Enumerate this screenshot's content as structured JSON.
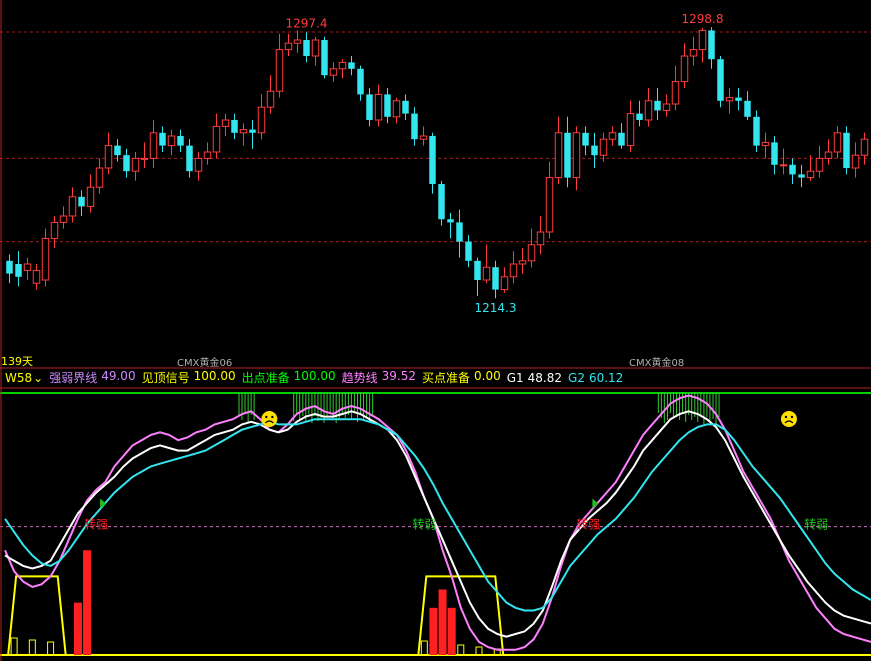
{
  "chart_data": {
    "type": "candlestick",
    "main": {
      "high_label": [
        "1297.4",
        "1298.8"
      ],
      "low_label": "1214.3",
      "period_label": "139天",
      "contract_labels": [
        "CMX黄金06",
        "CMX黄金08"
      ],
      "ylim": [
        1195,
        1305
      ],
      "candles": [
        [
          1226,
          1222,
          1228,
          1219
        ],
        [
          1225,
          1221,
          1229,
          1218
        ],
        [
          1223,
          1225,
          1227,
          1220
        ],
        [
          1219,
          1223,
          1225,
          1217
        ],
        [
          1220,
          1233,
          1236,
          1218
        ],
        [
          1233,
          1238,
          1240,
          1230
        ],
        [
          1238,
          1240,
          1243,
          1236
        ],
        [
          1240,
          1246,
          1249,
          1238
        ],
        [
          1246,
          1243,
          1248,
          1240
        ],
        [
          1243,
          1249,
          1253,
          1241
        ],
        [
          1249,
          1255,
          1258,
          1247
        ],
        [
          1255,
          1262,
          1266,
          1253
        ],
        [
          1262,
          1259,
          1264,
          1257
        ],
        [
          1259,
          1254,
          1261,
          1252
        ],
        [
          1254,
          1258,
          1260,
          1251
        ],
        [
          1258,
          1258,
          1263,
          1255
        ],
        [
          1258,
          1266,
          1270,
          1255
        ],
        [
          1266,
          1262,
          1268,
          1260
        ],
        [
          1262,
          1265,
          1267,
          1259
        ],
        [
          1265,
          1262,
          1267,
          1260
        ],
        [
          1262,
          1254,
          1264,
          1252
        ],
        [
          1254,
          1258,
          1260,
          1251
        ],
        [
          1258,
          1260,
          1263,
          1256
        ],
        [
          1260,
          1268,
          1272,
          1258
        ],
        [
          1268,
          1270,
          1272,
          1265
        ],
        [
          1270,
          1266,
          1272,
          1264
        ],
        [
          1266,
          1267,
          1269,
          1262
        ],
        [
          1267,
          1266,
          1270,
          1261
        ],
        [
          1266,
          1274,
          1278,
          1264
        ],
        [
          1274,
          1279,
          1284,
          1272
        ],
        [
          1279,
          1292,
          1297,
          1277
        ],
        [
          1292,
          1294,
          1297,
          1290
        ],
        [
          1294,
          1295,
          1298,
          1291
        ],
        [
          1295,
          1290,
          1297.4,
          1288
        ],
        [
          1290,
          1295,
          1296,
          1287
        ],
        [
          1295,
          1284,
          1296,
          1283
        ],
        [
          1284,
          1286,
          1288,
          1282
        ],
        [
          1286,
          1288,
          1289,
          1283
        ],
        [
          1288,
          1286,
          1290,
          1284
        ],
        [
          1286,
          1278,
          1287,
          1276
        ],
        [
          1278,
          1270,
          1280,
          1268
        ],
        [
          1270,
          1278,
          1281,
          1268
        ],
        [
          1278,
          1271,
          1280,
          1269
        ],
        [
          1271,
          1276,
          1277,
          1269
        ],
        [
          1276,
          1272,
          1278,
          1270
        ],
        [
          1272,
          1264,
          1274,
          1262
        ],
        [
          1264,
          1265,
          1268,
          1262
        ],
        [
          1265,
          1250,
          1266,
          1247
        ],
        [
          1250,
          1239,
          1251,
          1237
        ],
        [
          1239,
          1238,
          1241,
          1233
        ],
        [
          1238,
          1232,
          1242,
          1227
        ],
        [
          1232,
          1226,
          1234,
          1224
        ],
        [
          1226,
          1220,
          1227,
          1215
        ],
        [
          1220,
          1224,
          1231,
          1219
        ],
        [
          1224,
          1217,
          1226,
          1214.3
        ],
        [
          1217,
          1221,
          1224,
          1216
        ],
        [
          1221,
          1225,
          1229,
          1219
        ],
        [
          1225,
          1226,
          1230,
          1222
        ],
        [
          1226,
          1231,
          1236,
          1224
        ],
        [
          1231,
          1235,
          1240,
          1228
        ],
        [
          1235,
          1252,
          1257,
          1233
        ],
        [
          1252,
          1266,
          1271,
          1250
        ],
        [
          1266,
          1252,
          1271,
          1249
        ],
        [
          1252,
          1266,
          1268,
          1248
        ],
        [
          1266,
          1262,
          1268,
          1259
        ],
        [
          1262,
          1259,
          1266,
          1255
        ],
        [
          1259,
          1264,
          1266,
          1257
        ],
        [
          1264,
          1266,
          1268,
          1262
        ],
        [
          1266,
          1262,
          1269,
          1261
        ],
        [
          1262,
          1272,
          1276,
          1260
        ],
        [
          1272,
          1270,
          1276,
          1268
        ],
        [
          1270,
          1276,
          1280,
          1268
        ],
        [
          1276,
          1273,
          1280,
          1270
        ],
        [
          1273,
          1275,
          1278,
          1271
        ],
        [
          1275,
          1282,
          1287,
          1273
        ],
        [
          1282,
          1290,
          1294,
          1280
        ],
        [
          1290,
          1292,
          1296,
          1287
        ],
        [
          1292,
          1298,
          1298.8,
          1288
        ],
        [
          1298,
          1289,
          1299,
          1286
        ],
        [
          1289,
          1276,
          1290,
          1274
        ],
        [
          1276,
          1277,
          1280,
          1272
        ],
        [
          1277,
          1276,
          1280,
          1273
        ],
        [
          1276,
          1271,
          1279,
          1270
        ],
        [
          1271,
          1262,
          1273,
          1260
        ],
        [
          1262,
          1263,
          1266,
          1258
        ],
        [
          1263,
          1256,
          1265,
          1253
        ],
        [
          1256,
          1256,
          1261,
          1253
        ],
        [
          1256,
          1253,
          1258,
          1250
        ],
        [
          1253,
          1252,
          1256,
          1249
        ],
        [
          1252,
          1254,
          1259,
          1251
        ],
        [
          1254,
          1258,
          1262,
          1252
        ],
        [
          1258,
          1260,
          1264,
          1256
        ],
        [
          1260,
          1266,
          1268,
          1258
        ],
        [
          1266,
          1255,
          1268,
          1253
        ],
        [
          1255,
          1259,
          1263,
          1252
        ],
        [
          1259,
          1264,
          1266,
          1256
        ]
      ]
    },
    "indicator": {
      "name": "W58",
      "legend": [
        {
          "label": "强弱界线",
          "value": "49.00",
          "color": "#cc88ff"
        },
        {
          "label": "见顶信号",
          "value": "100.00",
          "color": "#ffff00"
        },
        {
          "label": "出点准备",
          "value": "100.00",
          "color": "#00ff00"
        },
        {
          "label": "趋势线",
          "value": "39.52",
          "color": "#ff80ff"
        },
        {
          "label": "买点准备",
          "value": "0.00",
          "color": "#ffff00"
        },
        {
          "label": "G1",
          "value": "48.82",
          "color": "#ffffff"
        },
        {
          "label": "G2",
          "value": "60.12",
          "color": "#33e5ee"
        }
      ],
      "ylim": [
        0,
        100
      ],
      "boundary_level": 49,
      "top_level": 100,
      "annotations": [
        {
          "text": "转强",
          "color": "#ff2020",
          "x": 10
        },
        {
          "text": "转弱",
          "color": "#20d020",
          "x": 46
        },
        {
          "text": "转强",
          "color": "#ff2020",
          "x": 64
        },
        {
          "text": "转弱",
          "color": "#20d020",
          "x": 89
        }
      ],
      "series_trend": [
        40,
        32,
        28,
        26,
        27,
        30,
        36,
        44,
        52,
        59,
        63,
        66,
        72,
        76,
        80,
        82,
        84,
        85,
        84,
        82,
        83,
        85,
        86,
        88,
        89,
        90,
        92,
        93,
        90,
        86,
        85,
        88,
        92,
        94,
        95,
        93,
        92,
        94,
        95,
        94,
        92,
        90,
        87,
        84,
        78,
        70,
        60,
        52,
        40,
        30,
        18,
        10,
        5,
        3,
        2,
        2,
        2,
        3,
        6,
        12,
        22,
        34,
        44,
        50,
        54,
        58,
        62,
        66,
        72,
        78,
        84,
        88,
        92,
        96,
        98,
        99,
        98,
        96,
        92,
        86,
        78,
        70,
        64,
        58,
        52,
        44,
        36,
        30,
        24,
        18,
        14,
        10,
        8,
        7,
        6,
        5
      ],
      "series_g1": [
        38,
        36,
        34,
        33,
        34,
        36,
        42,
        48,
        54,
        58,
        62,
        65,
        68,
        72,
        75,
        77,
        79,
        80,
        79,
        78,
        78,
        80,
        82,
        84,
        85,
        86,
        88,
        89,
        88,
        86,
        85,
        86,
        89,
        91,
        92,
        91,
        91,
        92,
        93,
        92,
        90,
        88,
        86,
        82,
        76,
        68,
        60,
        52,
        44,
        36,
        28,
        20,
        14,
        10,
        8,
        7,
        8,
        9,
        12,
        17,
        26,
        36,
        44,
        48,
        52,
        55,
        58,
        62,
        67,
        72,
        78,
        82,
        86,
        90,
        92,
        93,
        92,
        90,
        87,
        82,
        75,
        68,
        62,
        56,
        50,
        44,
        38,
        33,
        28,
        24,
        20,
        17,
        15,
        14,
        13,
        12
      ],
      "series_g2": [
        52,
        47,
        42,
        38,
        35,
        34,
        36,
        40,
        45,
        50,
        54,
        58,
        62,
        65,
        68,
        70,
        72,
        73,
        74,
        75,
        76,
        77,
        78,
        80,
        82,
        84,
        86,
        87,
        88,
        89,
        88,
        88,
        88,
        89,
        90,
        90,
        90,
        90,
        90,
        90,
        89,
        88,
        86,
        84,
        80,
        76,
        71,
        65,
        58,
        52,
        46,
        40,
        34,
        28,
        24,
        20,
        18,
        17,
        17,
        18,
        22,
        28,
        34,
        38,
        42,
        46,
        49,
        52,
        56,
        60,
        65,
        70,
        74,
        78,
        82,
        85,
        87,
        88,
        88,
        86,
        82,
        77,
        72,
        68,
        64,
        60,
        55,
        50,
        45,
        40,
        35,
        31,
        28,
        25,
        23,
        21
      ],
      "bars": [
        [
          8,
          20
        ],
        [
          9,
          40
        ],
        [
          47,
          18
        ],
        [
          48,
          25
        ],
        [
          49,
          18
        ]
      ]
    }
  }
}
